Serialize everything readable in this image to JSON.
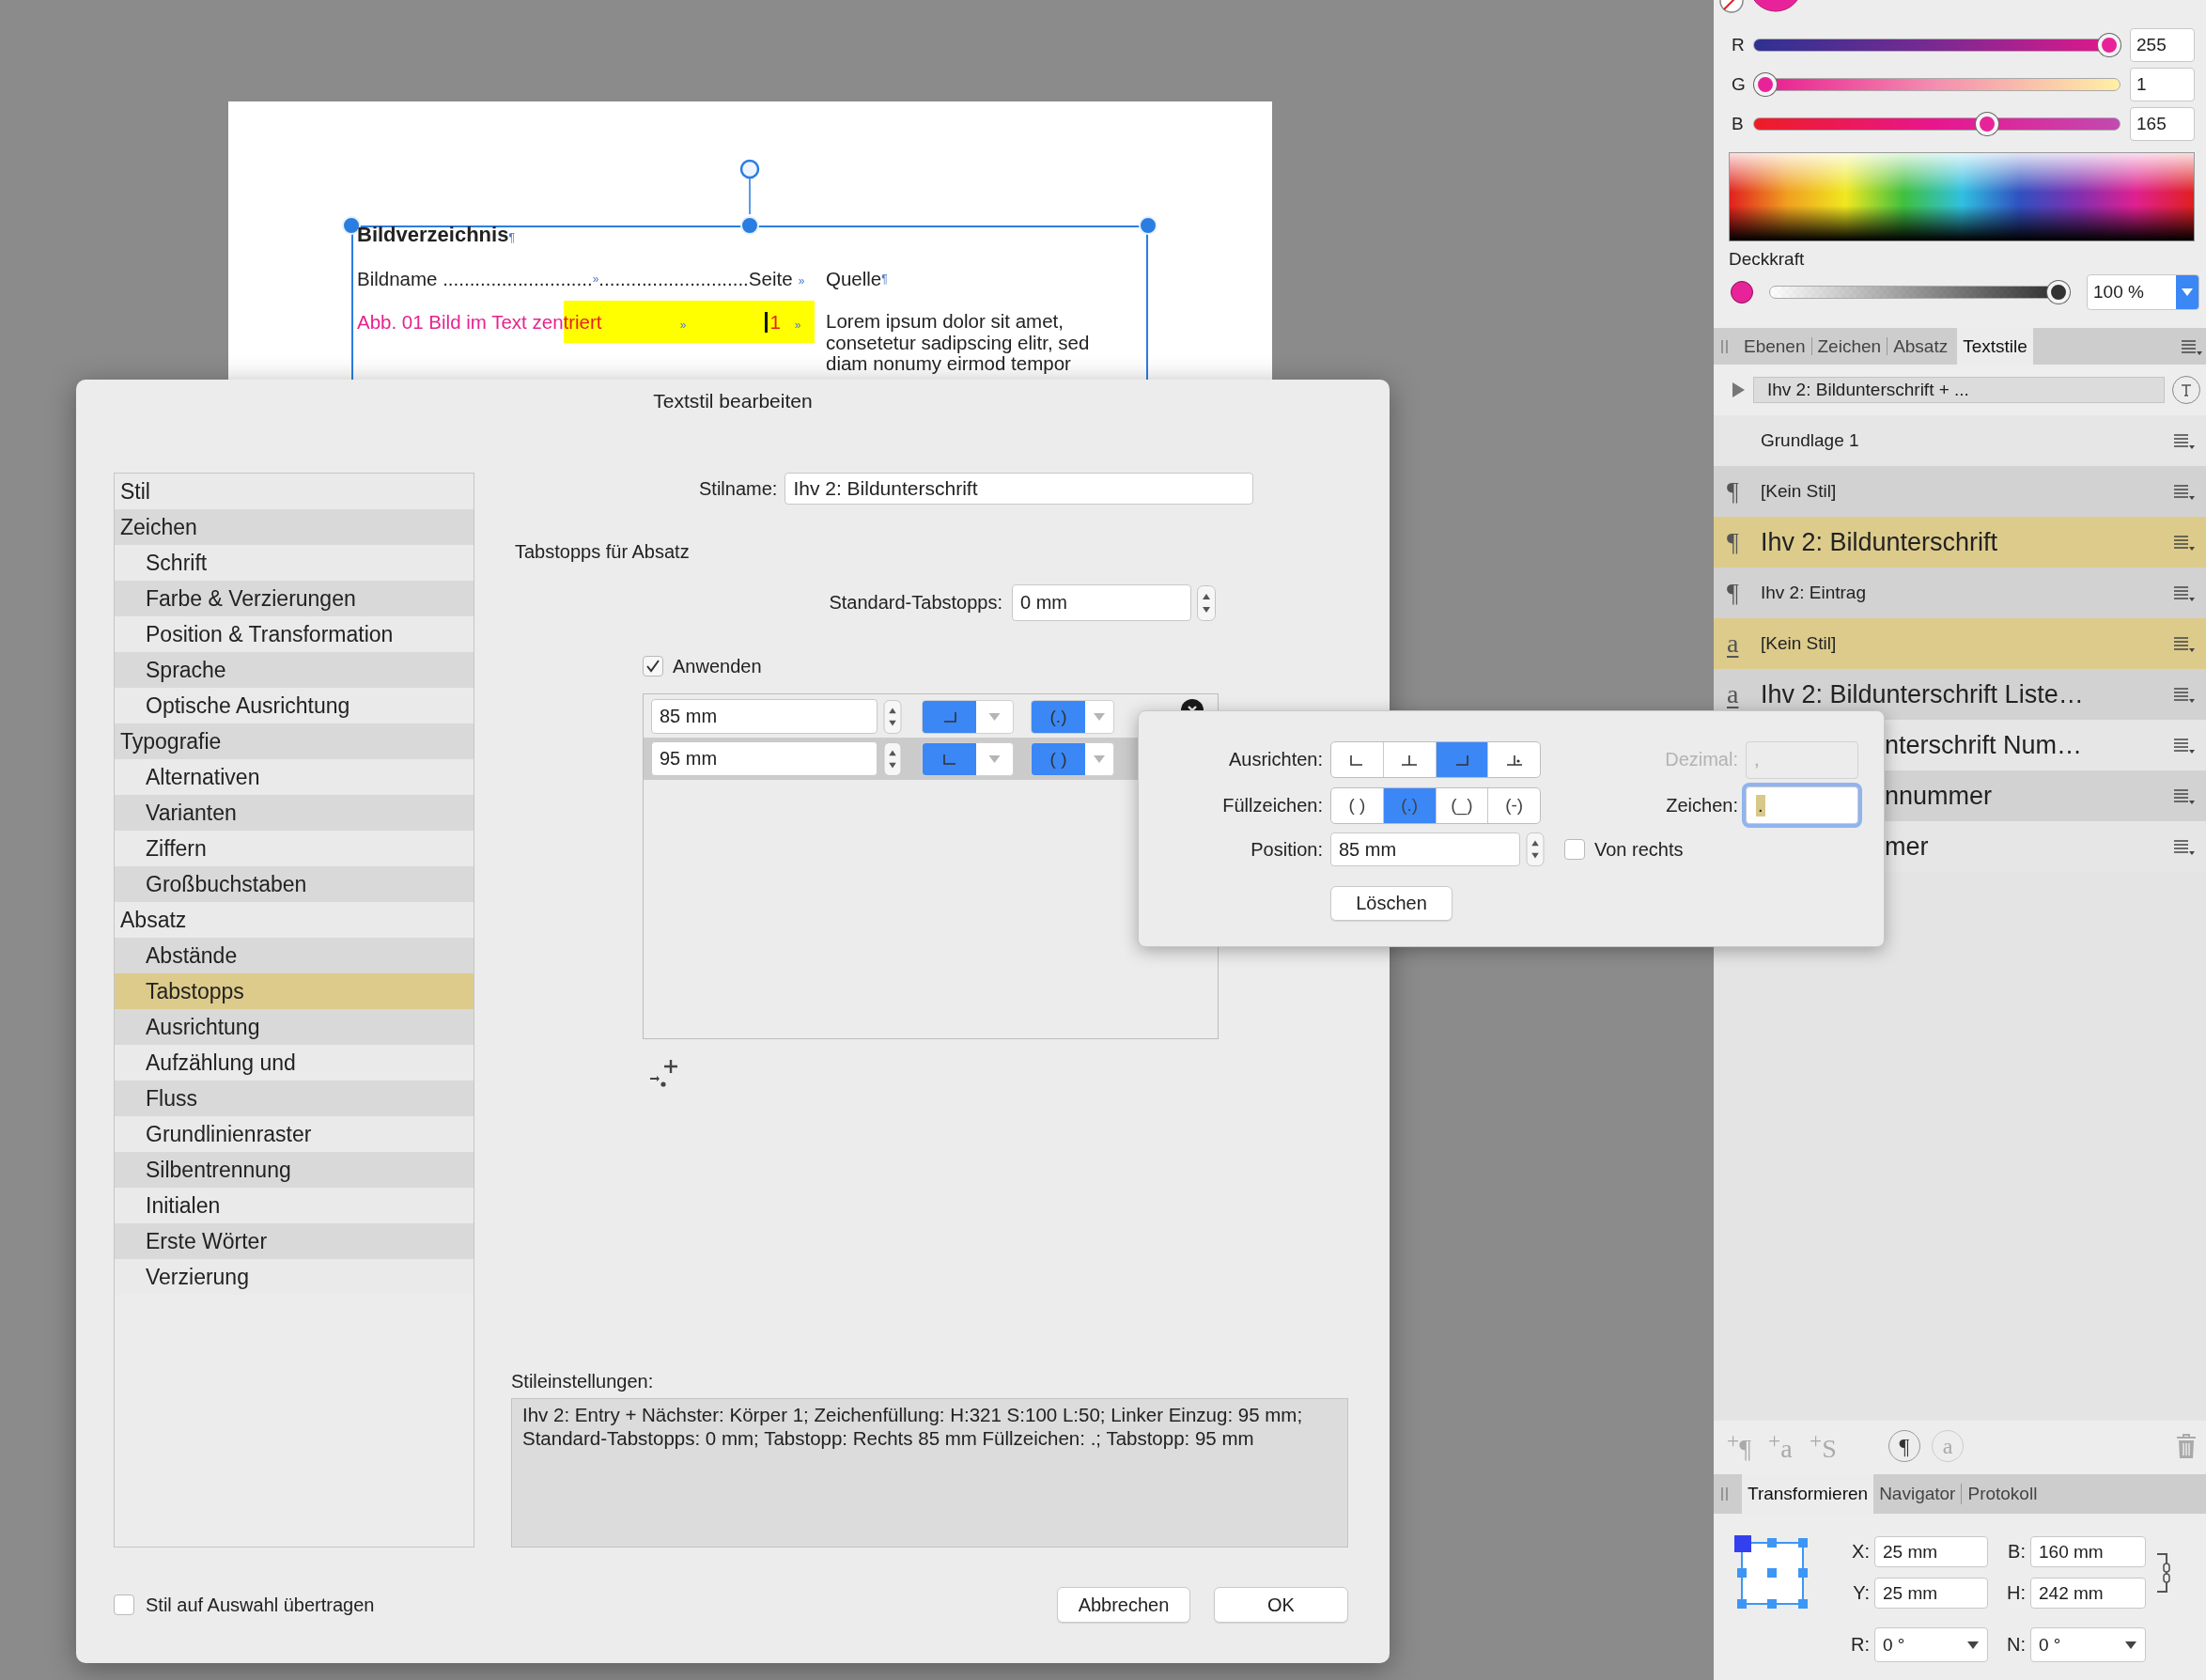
{
  "document": {
    "heading": "Bildverzeichnis",
    "heading_mark": "¶",
    "header": {
      "name": "Bildname ............................",
      "mid_mark": "»",
      "page": "............................Seite",
      "page_mark": "»",
      "source": "Quelle",
      "source_mark": "¶"
    },
    "entry": {
      "caption": "Abb. 01 Bild im Text zen",
      "caption_highlighted": "triert",
      "mid_mark": "»",
      "page": "1",
      "page_mark": "»",
      "source": "Lorem ipsum dolor sit amet, consetetur sadipscing elitr, sed diam nonumy eirmod tempor"
    }
  },
  "dialog": {
    "title": "Textstil bearbeiten",
    "categories": [
      {
        "label": "Stil",
        "selected": false
      },
      {
        "label": "Zeichen",
        "selected": false,
        "children": [
          {
            "label": "Schrift",
            "selected": false
          },
          {
            "label": "Farbe & Verzierungen",
            "selected": false
          },
          {
            "label": "Position & Transformation",
            "selected": false
          },
          {
            "label": "Sprache",
            "selected": false
          },
          {
            "label": "Optische Ausrichtung",
            "selected": false
          }
        ]
      },
      {
        "label": "Typografie",
        "selected": false,
        "children": [
          {
            "label": "Alternativen",
            "selected": false
          },
          {
            "label": "Varianten",
            "selected": false
          },
          {
            "label": "Ziffern",
            "selected": false
          },
          {
            "label": "Großbuchstaben",
            "selected": false
          }
        ]
      },
      {
        "label": "Absatz",
        "selected": false,
        "children": [
          {
            "label": "Abstände",
            "selected": false
          },
          {
            "label": "Tabstopps",
            "selected": true
          },
          {
            "label": "Ausrichtung",
            "selected": false
          },
          {
            "label": "Aufzählung und",
            "selected": false
          },
          {
            "label": "Fluss",
            "selected": false
          },
          {
            "label": "Grundlinienraster",
            "selected": false
          },
          {
            "label": "Silbentrennung",
            "selected": false
          },
          {
            "label": "Initialen",
            "selected": false
          },
          {
            "label": "Erste Wörter",
            "selected": false
          },
          {
            "label": "Verzierung",
            "selected": false
          }
        ]
      }
    ],
    "style_name_label": "Stilname:",
    "style_name": "Ihv 2: Bildunterschrift",
    "section_title": "Tabstopps für Absatz",
    "default_tabs_label": "Standard-Tabstopps:",
    "default_tabs_value": "0 mm",
    "apply": {
      "label": "Anwenden",
      "checked": true
    },
    "tab_stops": [
      {
        "position": "85 mm",
        "kind": "right",
        "leader": "(.)",
        "selected": false
      },
      {
        "position": "95 mm",
        "kind": "left",
        "leader": "( )",
        "selected": true
      }
    ],
    "summary_label": "Stileinstellungen:",
    "summary": "Ihv 2: Entry + Nächster: Körper 1; Zeichenfüllung: H:321 S:100 L:50; Linker Einzug: 95 mm; Standard-Tabstopps: 0 mm; Tabstopp: Rechts 85 mm Füllzeichen: .; Tabstopp: 95 mm",
    "apply_to_selection": {
      "label": "Stil auf Auswahl übertragen",
      "checked": false
    },
    "buttons": [
      "Abbrechen",
      "OK"
    ]
  },
  "tab_popover": {
    "align_label": "Ausrichten:",
    "align_options": [
      {
        "kind": "left",
        "selected": false
      },
      {
        "kind": "center",
        "selected": false
      },
      {
        "kind": "right",
        "selected": true
      },
      {
        "kind": "decimal",
        "selected": false
      }
    ],
    "fill_label": "Füllzeichen:",
    "fill_options": [
      {
        "label": "( )",
        "selected": false
      },
      {
        "label": "(.)",
        "selected": true
      },
      {
        "label": "(_)",
        "selected": false
      },
      {
        "label": "(-)",
        "selected": false
      }
    ],
    "decimal_label": "Dezimal:",
    "decimal_value": ",",
    "decimal_disabled": true,
    "char_label": "Zeichen:",
    "char_value": ".",
    "position_label": "Position:",
    "position_value": "85 mm",
    "from_right": {
      "label": "Von rechts",
      "checked": false
    },
    "delete_button": "Löschen"
  },
  "color_panel": {
    "channels": [
      {
        "label": "R",
        "level": 1,
        "value": "255"
      },
      {
        "label": "G",
        "level": 0.004,
        "value": "1"
      },
      {
        "label": "B",
        "level": 0.647,
        "value": "165"
      }
    ],
    "opacity": {
      "label": "Deckkraft",
      "level": 1,
      "value": "100 %"
    }
  },
  "studio_tabs": [
    {
      "label": "Ebenen",
      "selected": false
    },
    {
      "label": "Zeichen",
      "selected": false
    },
    {
      "label": "Absatz",
      "selected": false
    },
    {
      "label": "Textstile",
      "selected": true
    }
  ],
  "style_filter": "Ihv 2: Bildunterschrift + ...",
  "text_styles": [
    {
      "label": "Grundlage 1",
      "large": false,
      "covered": false,
      "selected": false
    },
    {
      "kind": "paragraph",
      "icon": "¶",
      "label": "[Kein Stil]",
      "large": false,
      "covered": false,
      "selected": false
    },
    {
      "kind": "paragraph",
      "icon": "¶",
      "label": "Ihv 2: Bildunterschrift",
      "large": true,
      "covered": false,
      "selected": true
    },
    {
      "kind": "paragraph",
      "icon": "¶",
      "label": "Ihv 2: Eintrag",
      "large": false,
      "covered": false,
      "selected": false
    },
    {
      "kind": "character",
      "icon": "a",
      "label": "[Kein Stil]",
      "large": false,
      "covered": false,
      "selected": true
    },
    {
      "kind": "character",
      "icon": "a",
      "label": "Ihv 2: Bildunterschrift Liste…",
      "large": true,
      "covered": false,
      "selected": false
    },
    {
      "label": "nterschrift Num…",
      "large": true,
      "covered": true,
      "selected": false
    },
    {
      "label": "nnummer",
      "large": true,
      "covered": true,
      "selected": false
    },
    {
      "label": "mer",
      "large": true,
      "covered": true,
      "selected": false
    }
  ],
  "style_toolbar": {
    "add": [
      "$^{+}$¶",
      "$^{+}$a",
      "$^{+}$S"
    ],
    "toggles": [
      {
        "glyph": "¶",
        "on": true
      },
      {
        "glyph": "a",
        "on": false
      }
    ]
  },
  "bottom_tabs": [
    {
      "label": "Transformieren",
      "selected": true
    },
    {
      "label": "Navigator",
      "selected": false
    },
    {
      "label": "Protokoll",
      "selected": false
    }
  ],
  "transform": {
    "fields": [
      {
        "label": "X:",
        "value": "25 mm"
      },
      {
        "label": "B:",
        "value": "160 mm"
      },
      {
        "label": "Y:",
        "value": "25 mm"
      },
      {
        "label": "H:",
        "value": "242 mm"
      }
    ],
    "rotation": {
      "label": "R:",
      "value": "0 °"
    },
    "shear": {
      "label": "N:",
      "value": "0 °"
    }
  }
}
